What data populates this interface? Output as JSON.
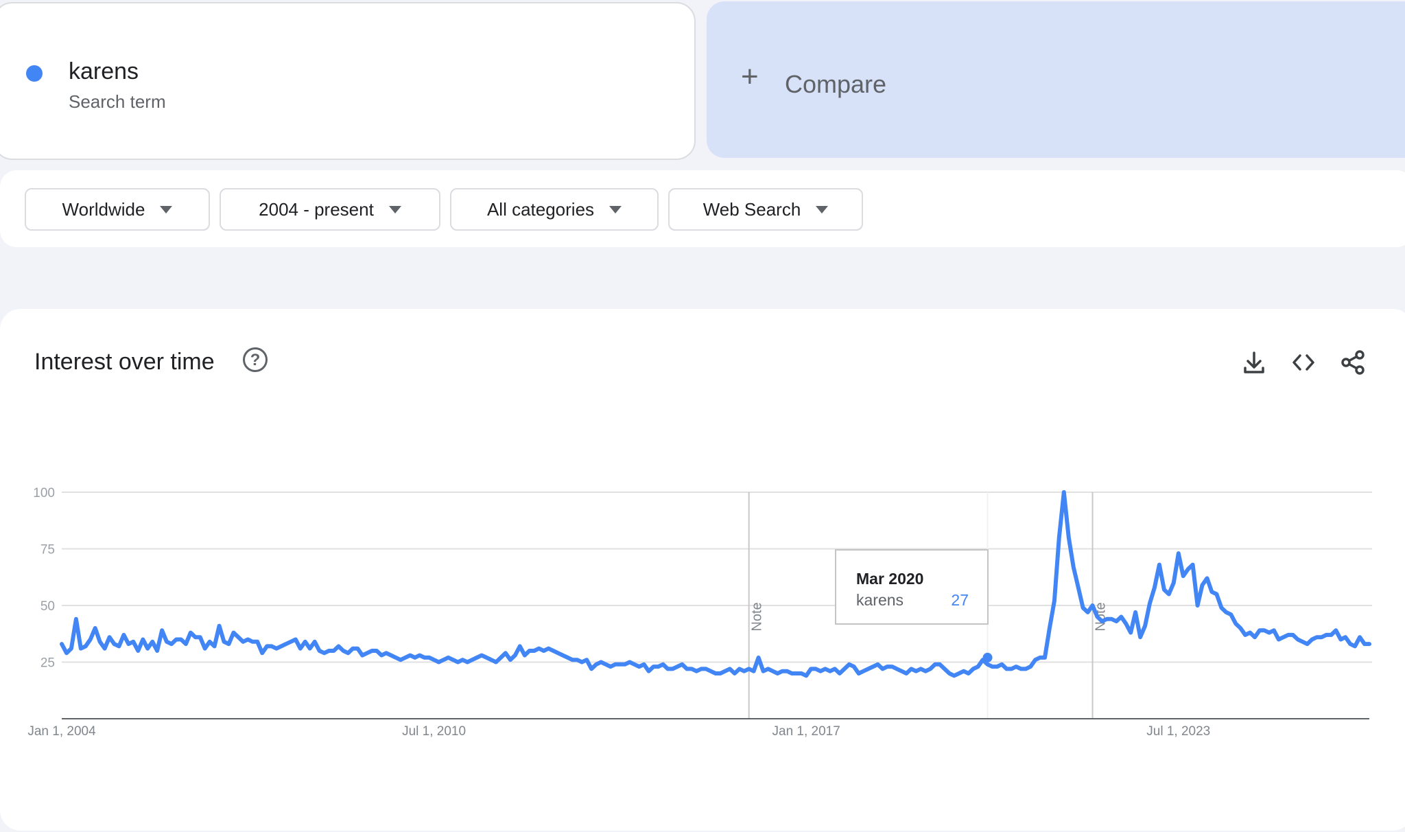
{
  "search_term": {
    "name": "karens",
    "subtitle": "Search term",
    "color": "#4285f4"
  },
  "compare": {
    "plus": "+",
    "label": "Compare"
  },
  "filters": {
    "region": "Worldwide",
    "time_range": "2004 - present",
    "category": "All categories",
    "search_type": "Web Search"
  },
  "chart_card": {
    "title": "Interest over time",
    "help_icon": "question-circle-icon",
    "actions": [
      "download-icon",
      "embed-code-icon",
      "share-icon"
    ]
  },
  "tooltip": {
    "date": "Mar 2020",
    "term": "karens",
    "value": "27"
  },
  "chart_data": {
    "type": "line",
    "title": "",
    "xlabel": "",
    "ylabel": "",
    "ylim": [
      0,
      100
    ],
    "yticks": [
      "25",
      "50",
      "75",
      "100"
    ],
    "xticks": [
      "Jan 1, 2004",
      "Jul 1, 2010",
      "Jan 1, 2017",
      "Jul 1, 2023"
    ],
    "grid": true,
    "line_color": "#4285f4",
    "notes": [
      {
        "label": "Note",
        "date": "2016-01"
      },
      {
        "label": "Note",
        "date": "2022-01"
      }
    ],
    "highlight": {
      "date": "2020-03",
      "value": 27
    },
    "series": [
      {
        "name": "karens",
        "start": "2004-01",
        "interval": "month",
        "values": [
          33,
          29,
          31,
          44,
          31,
          32,
          35,
          40,
          34,
          31,
          36,
          33,
          32,
          37,
          33,
          34,
          30,
          35,
          31,
          34,
          30,
          39,
          34,
          33,
          35,
          35,
          33,
          38,
          36,
          36,
          31,
          34,
          32,
          41,
          34,
          33,
          38,
          36,
          34,
          35,
          34,
          34,
          29,
          32,
          32,
          31,
          32,
          33,
          34,
          35,
          31,
          34,
          31,
          34,
          30,
          29,
          30,
          30,
          32,
          30,
          29,
          31,
          31,
          28,
          29,
          30,
          30,
          28,
          29,
          28,
          27,
          26,
          27,
          28,
          27,
          28,
          27,
          27,
          26,
          25,
          26,
          27,
          26,
          25,
          26,
          25,
          26,
          27,
          28,
          27,
          26,
          25,
          27,
          29,
          26,
          28,
          32,
          28,
          30,
          30,
          31,
          30,
          31,
          30,
          29,
          28,
          27,
          26,
          26,
          25,
          26,
          22,
          24,
          25,
          24,
          23,
          24,
          24,
          24,
          25,
          24,
          23,
          24,
          21,
          23,
          23,
          24,
          22,
          22,
          23,
          24,
          22,
          22,
          21,
          22,
          22,
          21,
          20,
          20,
          21,
          22,
          20,
          22,
          21,
          22,
          21,
          27,
          21,
          22,
          21,
          20,
          21,
          21,
          20,
          20,
          20,
          19,
          22,
          22,
          21,
          22,
          21,
          22,
          20,
          22,
          24,
          23,
          20,
          21,
          22,
          23,
          24,
          22,
          23,
          23,
          22,
          21,
          20,
          22,
          21,
          22,
          21,
          22,
          24,
          24,
          22,
          20,
          19,
          20,
          21,
          20,
          22,
          23,
          26,
          24,
          23,
          23,
          24,
          22,
          22,
          23,
          22,
          22,
          23,
          26,
          27,
          27,
          40,
          52,
          80,
          100,
          80,
          67,
          58,
          49,
          47,
          50,
          45,
          43,
          44,
          44,
          43,
          45,
          42,
          38,
          47,
          36,
          41,
          51,
          58,
          68,
          57,
          55,
          60,
          73,
          63,
          66,
          68,
          50,
          59,
          62,
          56,
          55,
          49,
          47,
          46,
          42,
          40,
          37,
          38,
          36,
          39,
          39,
          38,
          39,
          35,
          36,
          37,
          37,
          35,
          34,
          33,
          35,
          36,
          36,
          37,
          37,
          39,
          35,
          36,
          33,
          32,
          36,
          33,
          33
        ]
      }
    ]
  }
}
